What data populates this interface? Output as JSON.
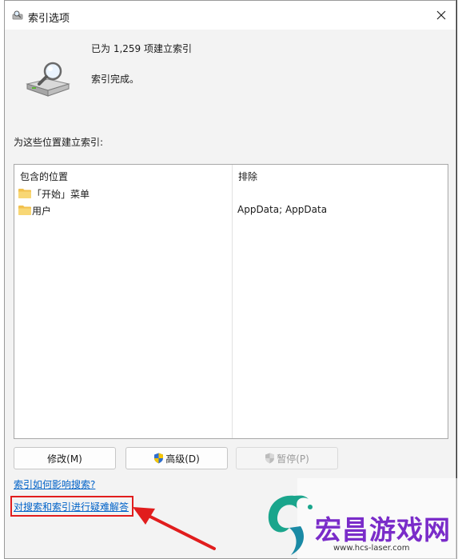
{
  "window": {
    "title": "索引选项",
    "close_icon": "close-icon"
  },
  "status": {
    "count_text": "已为 1,259 项建立索引",
    "state_text": "索引完成。"
  },
  "locations": {
    "label": "为这些位置建立索引:",
    "header_included": "包含的位置",
    "header_excluded": "排除",
    "rows": [
      {
        "name": "「开始」菜单",
        "excluded": ""
      },
      {
        "name": "用户",
        "excluded": "AppData; AppData"
      }
    ]
  },
  "buttons": {
    "modify": "修改(M)",
    "advanced": "高级(D)",
    "pause": "暂停(P)"
  },
  "links": {
    "how_index_affects": "索引如何影响搜索?",
    "troubleshoot": "对搜索和索引进行疑难解答"
  },
  "watermark": {
    "title": "宏昌游戏网",
    "url": "www.hcs-laser.com"
  },
  "colors": {
    "link": "#0062c8",
    "highlight": "#e11d1d",
    "watermark": "#7a2cc9"
  }
}
